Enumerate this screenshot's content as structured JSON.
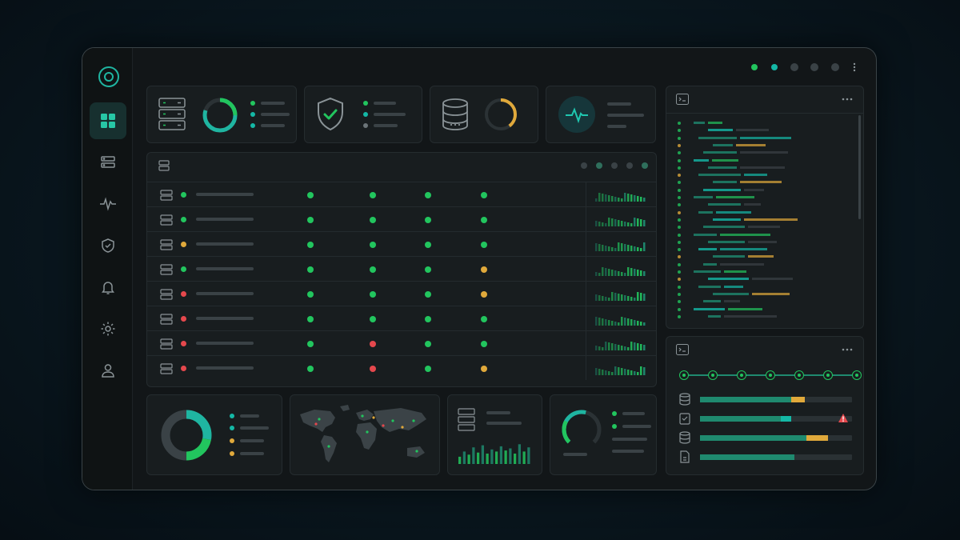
{
  "colors": {
    "accent": "#22c55e",
    "teal": "#14b8a6",
    "warning": "#e0a93b",
    "error": "#e5484d",
    "panel": "#181d1f"
  },
  "window_controls": [
    "status-dot-green",
    "status-dot-teal",
    "status-dot-gray",
    "status-dot-gray",
    "status-dot-gray",
    "more-vertical-icon"
  ],
  "sidebar": {
    "logo": "logo-ring-icon",
    "items": [
      {
        "icon": "dashboard-grid-icon",
        "active": true
      },
      {
        "icon": "server-icon",
        "active": false
      },
      {
        "icon": "pulse-icon",
        "active": false
      },
      {
        "icon": "shield-icon",
        "active": false
      },
      {
        "icon": "bell-icon",
        "active": false
      },
      {
        "icon": "gear-icon",
        "active": false
      },
      {
        "icon": "user-icon",
        "active": false
      }
    ]
  },
  "summary_cards": [
    {
      "icon": "server-stack-icon",
      "gauge": 0.8,
      "legend_colors": [
        "#22c55e",
        "#14b8a6",
        "#14b8a6"
      ]
    },
    {
      "icon": "shield-check-icon",
      "legend_colors": [
        "#22c55e",
        "#14b8a6",
        "#6b7478"
      ]
    },
    {
      "icon": "database-icon",
      "gauge": 0.4
    },
    {
      "icon": "heartbeat-icon"
    }
  ],
  "server_table": {
    "rows": [
      {
        "status": "ok",
        "checks": [
          "ok",
          "ok",
          "ok",
          "ok"
        ]
      },
      {
        "status": "ok",
        "checks": [
          "ok",
          "ok",
          "ok",
          "ok"
        ]
      },
      {
        "status": "warn",
        "checks": [
          "ok",
          "ok",
          "ok",
          "ok"
        ]
      },
      {
        "status": "ok",
        "checks": [
          "ok",
          "ok",
          "ok",
          "warn"
        ]
      },
      {
        "status": "error",
        "checks": [
          "ok",
          "ok",
          "ok",
          "warn"
        ]
      },
      {
        "status": "error",
        "checks": [
          "ok",
          "ok",
          "ok",
          "ok"
        ]
      },
      {
        "status": "error",
        "checks": [
          "ok",
          "error",
          "ok",
          "ok"
        ]
      },
      {
        "status": "error",
        "checks": [
          "ok",
          "error",
          "ok",
          "warn"
        ]
      }
    ]
  },
  "terminal": {
    "icon": "terminal-icon",
    "menu": "more-horizontal-icon"
  },
  "pipeline": {
    "icon": "terminal-icon",
    "menu": "more-horizontal-icon",
    "steps": 7,
    "jobs": [
      {
        "icon": "database-icon",
        "progress": 0.6,
        "extra": 0.09,
        "extra_color": "#e0a93b",
        "alert": false
      },
      {
        "icon": "clipboard-icon",
        "progress": 0.53,
        "extra": 0.07,
        "extra_color": "#14b8a6",
        "alert": true
      },
      {
        "icon": "database-icon",
        "progress": 0.7,
        "extra": 0.14,
        "extra_color": "#e0a93b",
        "alert": false
      },
      {
        "icon": "file-icon",
        "progress": 0.62,
        "extra": 0,
        "extra_color": "#22c55e",
        "alert": false
      }
    ]
  },
  "bottom_cards": {
    "donut": {
      "segments": [
        0.28,
        0.22,
        0.5
      ],
      "legend_colors": [
        "#14b8a6",
        "#14b8a6",
        "#e0a93b",
        "#e0a93b"
      ]
    },
    "map": {
      "icon": "world-map-icon"
    },
    "histogram": {
      "values": [
        0.35,
        0.6,
        0.45,
        0.8,
        0.55,
        0.9,
        0.5,
        0.7,
        0.6,
        0.85,
        0.65,
        0.75,
        0.5,
        0.95,
        0.6,
        0.8
      ]
    },
    "gauge": {
      "value": 0.55,
      "legend_colors": [
        "#22c55e",
        "#22c55e"
      ]
    }
  }
}
